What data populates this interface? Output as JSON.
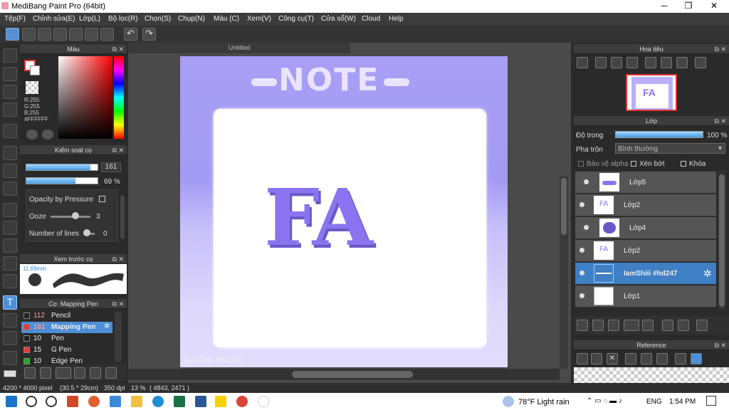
{
  "window": {
    "title": "MediBang Paint Pro (64bit)",
    "minimize": "─",
    "maximize": "❐",
    "close": "✕"
  },
  "menu": [
    "Tệp(F)",
    "Chỉnh sửa(E)",
    "Lớp(L)",
    "Bộ lọc(R)",
    "Chọn(S)",
    "Chụp(N)",
    "Màu (C)",
    "Xem(V)",
    "Công cụ(T)",
    "Cửa sổ(W)",
    "Cloud",
    "Help"
  ],
  "color_panel": {
    "title": "Màu",
    "r": "R:255",
    "g": "G:255",
    "b": "B:255",
    "hex": "#FFFFFF"
  },
  "brush_control": {
    "title": "Kiểm soát cọ",
    "size": "161",
    "opacity": "69 %",
    "opacity_by_pressure": "Opacity by Pressure",
    "ooze_label": "Ooze",
    "ooze_value": "3",
    "lines_label": "Number of lines",
    "lines_value": "0",
    "size_fraction": 0.9,
    "opacity_fraction": 0.69
  },
  "brush_preview": {
    "title": "Xem trước cọ",
    "size": "11.69mm"
  },
  "brushes": {
    "title": "Cọ: Mapping Pen",
    "items": [
      {
        "num": "112",
        "name": "Pencil",
        "swatch": "#222222"
      },
      {
        "num": "161",
        "name": "Mapping Pen",
        "swatch": "#e23b3b",
        "selected": true
      },
      {
        "num": "10",
        "name": "Pen",
        "swatch": "#222222"
      },
      {
        "num": "15",
        "name": "G Pen",
        "swatch": "#e23b3b"
      },
      {
        "num": "10",
        "name": "Edge Pen",
        "swatch": "#22aa22"
      }
    ]
  },
  "canvas": {
    "tab": "Untitled",
    "note_text": "NOTE",
    "art_text": "FA",
    "watermark": "IamShiii #hd247"
  },
  "navigator": {
    "title": "Hoa tiêu",
    "thumb_text": "FA"
  },
  "layers": {
    "title": "Lớp",
    "opacity_label": "Độ trong",
    "opacity_value": "100 %",
    "opacity_fraction": 1.0,
    "blend_label": "Pha trộn",
    "blend_value": "Bình thường",
    "protect_alpha": "Bảo vệ alpha",
    "clipping": "Xén bớt",
    "lock": "Khóa",
    "items": [
      {
        "name": "Lớp5"
      },
      {
        "name": "Lớp2"
      },
      {
        "name": "Lớp4"
      },
      {
        "name": "Lớp2"
      },
      {
        "name": "IamShiii #hd247",
        "selected": true
      },
      {
        "name": "Lớp1"
      }
    ]
  },
  "reference": {
    "title": "Reference"
  },
  "status": {
    "size": "4200 * 4000 pixel",
    "cm": "(30.5 * 29cm)",
    "dpi": "350 dpi",
    "zoom": "13 %",
    "coords": "( 4843, 2471 )"
  },
  "taskbar": {
    "weather": "78°F  Light rain",
    "lang": "ENG",
    "time": "1:54 PM"
  },
  "colors": {
    "accent": "#4c8fd6",
    "art_purple": "#8a74ef"
  }
}
